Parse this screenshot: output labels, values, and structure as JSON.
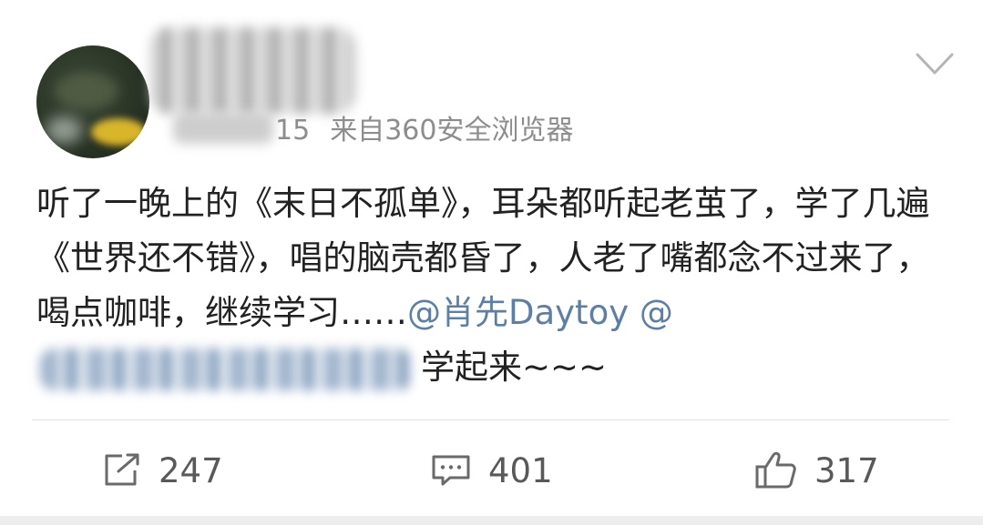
{
  "post": {
    "meta": {
      "date_partial": "15",
      "source_prefix": "来自",
      "source_app": "360安全浏览器"
    },
    "content": {
      "text_main": "听了一晚上的《末日不孤单》，耳朵都听起老茧了，学了几遍《世界还不错》，唱的脑壳都昏了，人老了嘴都念不过来了，喝点咖啡，继续学习……",
      "mention_1": "@肖先Daytoy",
      "mention_2_prefix": "@",
      "tail": "学起来~~~"
    }
  },
  "actions": {
    "repost_count": "247",
    "comment_count": "401",
    "like_count": "317"
  },
  "icons": {
    "menu": "chevron-down-icon",
    "repost": "share-icon",
    "comment": "comment-icon",
    "like": "thumbs-up-icon"
  },
  "colors": {
    "text": "#222222",
    "meta": "#8d8d8d",
    "link": "#5c7fa8",
    "action": "#595959"
  }
}
